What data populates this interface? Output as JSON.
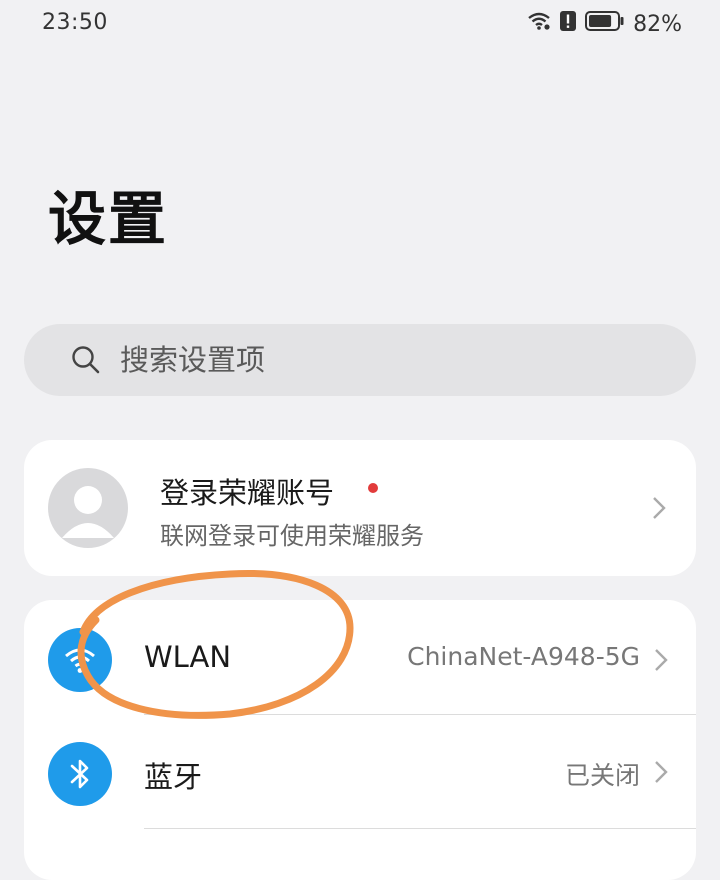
{
  "status_bar": {
    "time": "23:50",
    "battery_percent_label": "82%",
    "battery_level": 0.82
  },
  "header": {
    "title": "设置"
  },
  "search": {
    "placeholder": "搜索设置项"
  },
  "account": {
    "title": "登录荣耀账号",
    "subtitle": "联网登录可使用荣耀服务",
    "badge_color": "#e23b3b"
  },
  "settings": {
    "items": [
      {
        "label": "WLAN",
        "value": "ChinaNet-A948-5G",
        "icon": "wifi-icon"
      },
      {
        "label": "蓝牙",
        "value": "已关闭",
        "icon": "bluetooth-icon"
      }
    ]
  },
  "colors": {
    "accent_icon_bg": "#1f9bea",
    "annotation_stroke": "#f0944a"
  }
}
